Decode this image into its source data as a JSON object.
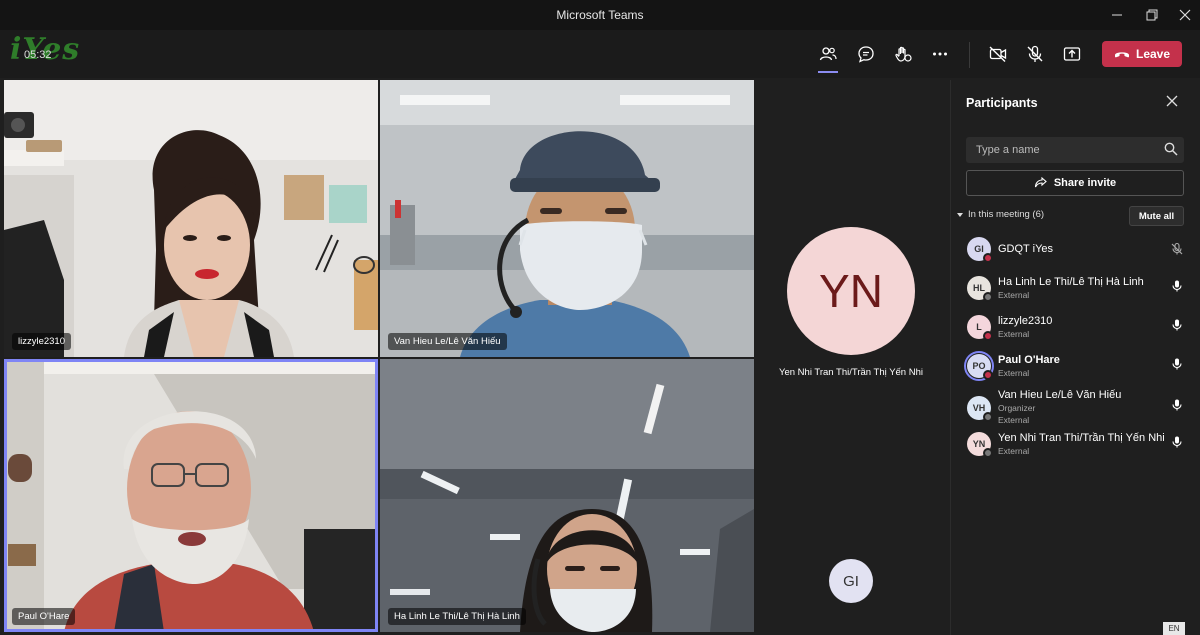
{
  "window": {
    "title": "Microsoft Teams"
  },
  "toolbar": {
    "logo_text": "iYes",
    "timer": "05:32",
    "leave_label": "Leave",
    "icons": [
      "people-icon",
      "chat-icon",
      "reactions-icon",
      "more-icon",
      "camera-off-icon",
      "mic-off-icon",
      "share-tray-icon"
    ]
  },
  "videos": [
    {
      "name": "lizzyle2310"
    },
    {
      "name": "Van Hieu Le/Lê Văn Hiếu"
    },
    {
      "name": "Paul O'Hare"
    },
    {
      "name": "Ha Linh Le Thi/Lê Thị Hà Linh"
    }
  ],
  "avatar_tiles": [
    {
      "initials": "YN",
      "name": "Yen Nhi Tran Thi/Trần Thị Yến Nhi"
    },
    {
      "initials": "GI",
      "name": ""
    }
  ],
  "panel": {
    "title": "Participants",
    "search_placeholder": "Type a name",
    "share_label": "Share invite",
    "section_label": "In this meeting (6)",
    "mute_all_label": "Mute all",
    "participants": [
      {
        "initials": "GI",
        "name": "GDQT iYes",
        "sub1": "",
        "sub2": "",
        "color": "#d8d8f0",
        "mic": "muted"
      },
      {
        "initials": "HL",
        "name": "Ha Linh Le Thi/Lê Thị Hà Linh",
        "sub1": "External",
        "sub2": "",
        "color": "#e8e4de",
        "mic": "on"
      },
      {
        "initials": "L",
        "name": "lizzyle2310",
        "sub1": "External",
        "sub2": "",
        "color": "#f4d6dc",
        "mic": "on"
      },
      {
        "initials": "PO",
        "name": "Paul O'Hare",
        "sub1": "External",
        "sub2": "",
        "color": "#d8dcf4",
        "mic": "on"
      },
      {
        "initials": "VH",
        "name": "Van Hieu Le/Lê Văn Hiếu",
        "sub1": "Organizer",
        "sub2": "External",
        "color": "#dce6f4",
        "mic": "on"
      },
      {
        "initials": "YN",
        "name": "Yen Nhi Tran Thi/Trần Thị Yến Nhi",
        "sub1": "External",
        "sub2": "",
        "color": "#f4dcdc",
        "mic": "on"
      }
    ]
  },
  "taskbar": {
    "lang": "EN"
  }
}
